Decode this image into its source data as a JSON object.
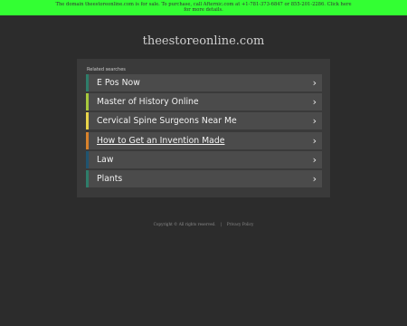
{
  "banner": {
    "text_line1": "The domain theestoreonline.com is for sale. To purchase, call Afternic.com at +1-781-373-6847 or 855-201-2286. Click here",
    "text_line2": "for more details.",
    "background": "#33ff33"
  },
  "site": {
    "title": "theestoreonline.com"
  },
  "related": {
    "header": "Related searches",
    "items": [
      {
        "label": "E Pos Now",
        "accent": "#2e7d6a",
        "icon": "chevron-right-icon"
      },
      {
        "label": "Master of History Online",
        "accent": "#a7c93d",
        "icon": "chevron-right-icon"
      },
      {
        "label": "Cervical Spine Surgeons Near Me",
        "accent": "#e8d44a",
        "icon": "chevron-right-icon"
      },
      {
        "label": "How to Get an Invention Made",
        "accent": "#d9822b",
        "icon": "chevron-right-icon",
        "visited": true
      },
      {
        "label": "Law",
        "accent": "#1f5470",
        "icon": "chevron-right-icon"
      },
      {
        "label": "Plants",
        "accent": "#2e7d6a",
        "icon": "chevron-right-icon"
      }
    ]
  },
  "footer": {
    "copyright": "Copyright © All rights reserved.",
    "separator": "|",
    "privacy": "Privacy Policy"
  }
}
